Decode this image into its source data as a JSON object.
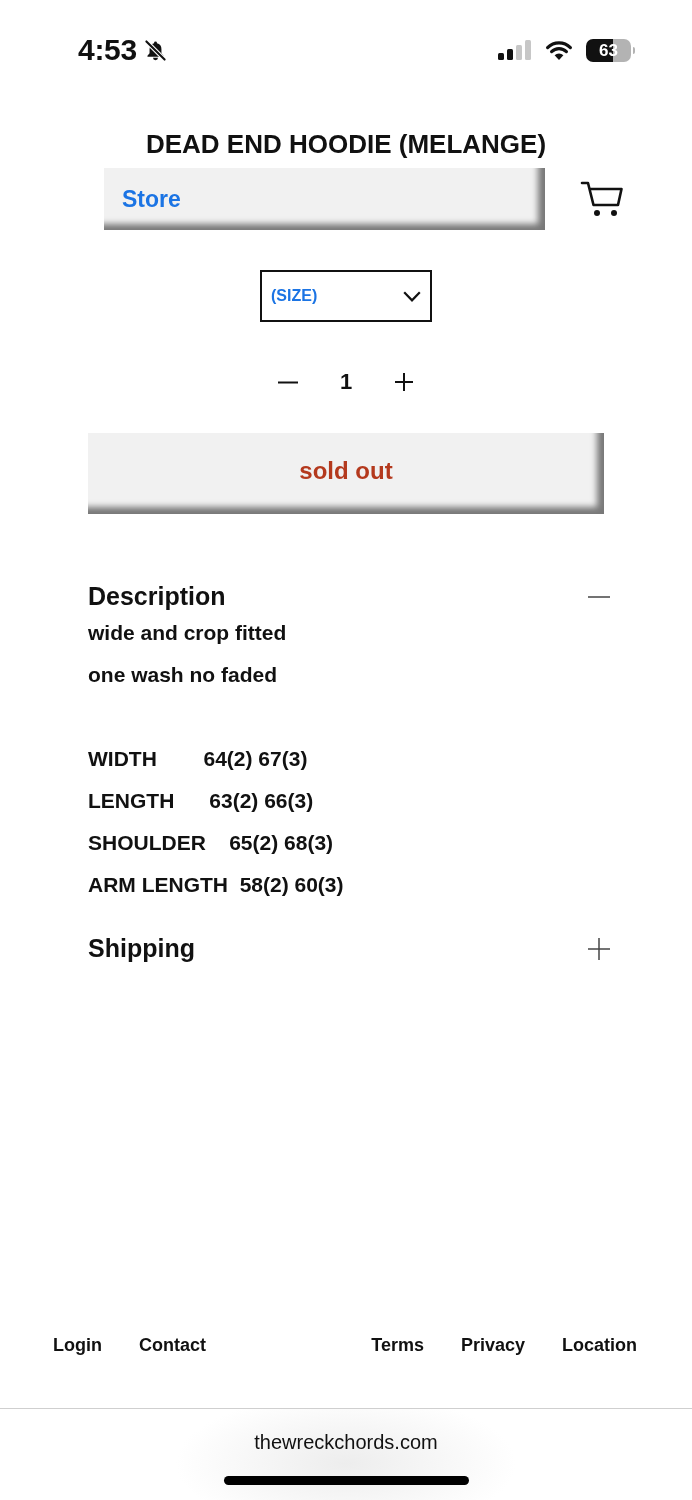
{
  "status_bar": {
    "time": "4:53",
    "silent": true,
    "battery": "63"
  },
  "product": {
    "title": "DEAD END HOODIE (MELANGE)"
  },
  "nav": {
    "link": "Store"
  },
  "size_select": {
    "value": "(SIZE)"
  },
  "quantity": {
    "value": "1"
  },
  "buy_button": {
    "label": "sold out"
  },
  "sections": [
    {
      "title": "Description",
      "expanded": true,
      "paragraphs": [
        "wide and crop fitted",
        "one wash no faded"
      ],
      "specs": [
        "WIDTH        64(2) 67(3)",
        "LENGTH      63(2) 66(3)",
        "SHOULDER    65(2) 68(3)",
        "ARM LENGTH  58(2) 60(3)"
      ]
    },
    {
      "title": "Shipping",
      "expanded": false
    }
  ],
  "footer": {
    "links_left": [
      "Login",
      "Contact"
    ],
    "links_right": [
      "Terms",
      "Privacy",
      "Location"
    ]
  },
  "browser": {
    "url": "thewreckchords.com"
  }
}
